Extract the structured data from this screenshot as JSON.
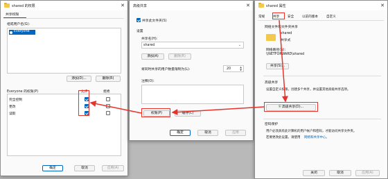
{
  "colors": {
    "accent": "#0067c0",
    "annotation": "#e8322a",
    "folder": "#f2c94c"
  },
  "perm": {
    "title": "shared 的权限",
    "tab": "共享权限",
    "group_label": "组或用户名(G):",
    "group_item": "Everyone",
    "add": "添加(D)...",
    "remove": "删除(R)",
    "perm_label": "Everyone 的权限(P)",
    "col_allow": "允许",
    "col_deny": "拒绝",
    "rows": [
      {
        "label": "完全控制",
        "allow": true,
        "deny": false
      },
      {
        "label": "更改",
        "allow": true,
        "deny": false
      },
      {
        "label": "读取",
        "allow": true,
        "deny": false
      }
    ],
    "ok": "确定",
    "cancel": "取消",
    "apply": "应用(A)"
  },
  "adv": {
    "title": "高级共享",
    "share_cb": "共享此文件夹(S)",
    "settings": "设置",
    "share_name_label": "共享名(H):",
    "share_name": "shared",
    "add": "添加(A)",
    "remove": "删除(R)",
    "limit_label": "将同时共享的用户数量限制为(L):",
    "limit_value": "20",
    "comment_label": "注释(O):",
    "perm_btn": "权限(P)",
    "cache_btn": "缓存(C)",
    "ok": "确定",
    "cancel": "取消",
    "apply": "应用"
  },
  "props": {
    "title": "shared 属性",
    "tabs": [
      "常规",
      "共享",
      "安全",
      "以前的版本",
      "自定义"
    ],
    "section_file": "网络文件和文件夹共享",
    "folder_name": "shared",
    "folder_status": "共享式",
    "path_label": "网络路径(N):",
    "path": "\\\\NETFORWARD\\shared",
    "share_btn": "共享(S)...",
    "section_adv": "高级共享",
    "adv_desc": "设置自定义权限，创建多个共享，并设置其他高级共享选项。",
    "adv_btn": "高级共享(D)...",
    "section_pw": "密码保护",
    "pw_desc1": "用户必须具有此计算机的用户帐户和密码，才能访问共享文件夹。",
    "pw_desc2": "若要更改此设置，请使用",
    "pw_link": "网络和共享中心。",
    "close": "关闭",
    "cancel": "取消",
    "apply": "应用(A)"
  }
}
